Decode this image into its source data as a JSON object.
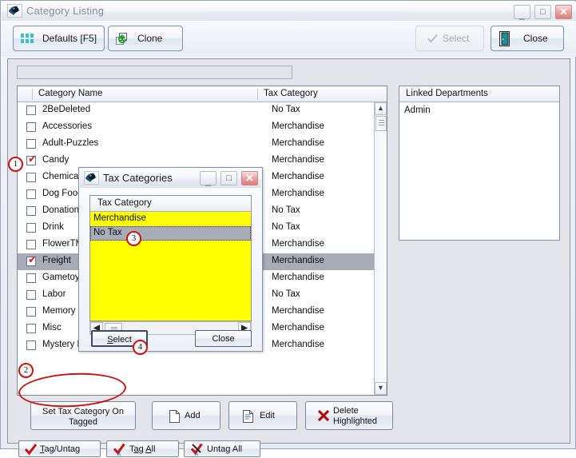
{
  "window": {
    "title": "Category Listing",
    "icon": "app-bird-icon",
    "controls": {
      "minimize": "_",
      "maximize": "□",
      "close": "✕"
    }
  },
  "toolbar": {
    "defaults_label": "Defaults [F5]",
    "clone_label": "Clone",
    "select_label": "Select",
    "select_disabled": true,
    "close_label": "Close"
  },
  "search": {
    "value": "",
    "placeholder": ""
  },
  "list": {
    "columns": [
      "",
      "Category Name",
      "Tax Category"
    ],
    "rows": [
      {
        "checked": false,
        "name": "2BeDeleted",
        "tax": "No Tax",
        "selected": false
      },
      {
        "checked": false,
        "name": "Accessories",
        "tax": "Merchandise",
        "selected": false
      },
      {
        "checked": false,
        "name": "Adult-Puzzles",
        "tax": "Merchandise",
        "selected": false
      },
      {
        "checked": true,
        "name": "Candy",
        "tax": "Merchandise",
        "selected": false
      },
      {
        "checked": false,
        "name": "Chemical",
        "tax": "Merchandise",
        "selected": false
      },
      {
        "checked": false,
        "name": "Dog Food",
        "tax": "Merchandise",
        "selected": false
      },
      {
        "checked": false,
        "name": "Donations",
        "tax": "No Tax",
        "selected": false
      },
      {
        "checked": false,
        "name": "Drink",
        "tax": "No Tax",
        "selected": false
      },
      {
        "checked": false,
        "name": "FlowerTM",
        "tax": "Merchandise",
        "selected": false
      },
      {
        "checked": true,
        "name": "Freight",
        "tax": "Merchandise",
        "selected": true
      },
      {
        "checked": false,
        "name": "Gametoy",
        "tax": "Merchandise",
        "selected": false
      },
      {
        "checked": false,
        "name": "Labor",
        "tax": "No Tax",
        "selected": false
      },
      {
        "checked": false,
        "name": "Memory C",
        "tax": "Merchandise",
        "selected": false
      },
      {
        "checked": false,
        "name": "Misc",
        "tax": "Merchandise",
        "selected": false
      },
      {
        "checked": false,
        "name": "Mystery B",
        "tax": "Merchandise",
        "selected": false
      }
    ],
    "scroll": {
      "up": "▲",
      "down": "▼"
    }
  },
  "departments": {
    "header": "Linked Departments",
    "items": [
      "Admin"
    ]
  },
  "actions": {
    "set_tax_label": "Set Tax Category On\nTagged",
    "add_label": "Add",
    "edit_label": "Edit",
    "delete_label": "Delete\nHighlighted",
    "tag_untag_label": "Tag/Untag",
    "tag_all_label": "Tag All",
    "untag_all_label": "Untag All"
  },
  "dialog": {
    "title": "Tax Categories",
    "icon": "app-bird-icon",
    "controls": {
      "minimize": "_",
      "maximize": "□",
      "close": "✕"
    },
    "list_header": "Tax Category",
    "items": [
      {
        "label": "Merchandise",
        "selected": false
      },
      {
        "label": "No Tax",
        "selected": true
      }
    ],
    "hscroll": {
      "left": "◀",
      "right": "▶"
    },
    "select_label": "Select",
    "close_label": "Close"
  },
  "annotations": [
    {
      "id": "1",
      "target": "candy-checkbox"
    },
    {
      "id": "2",
      "target": "set-tax-category-on-tagged-button"
    },
    {
      "id": "3",
      "target": "no-tax-row"
    },
    {
      "id": "4",
      "target": "dialog-select-button"
    }
  ],
  "colors": {
    "highlight": "#a8acb8",
    "dialog_list_bg": "#ffff00",
    "annotation": "#cc1111",
    "check": "#cc1f1f"
  }
}
